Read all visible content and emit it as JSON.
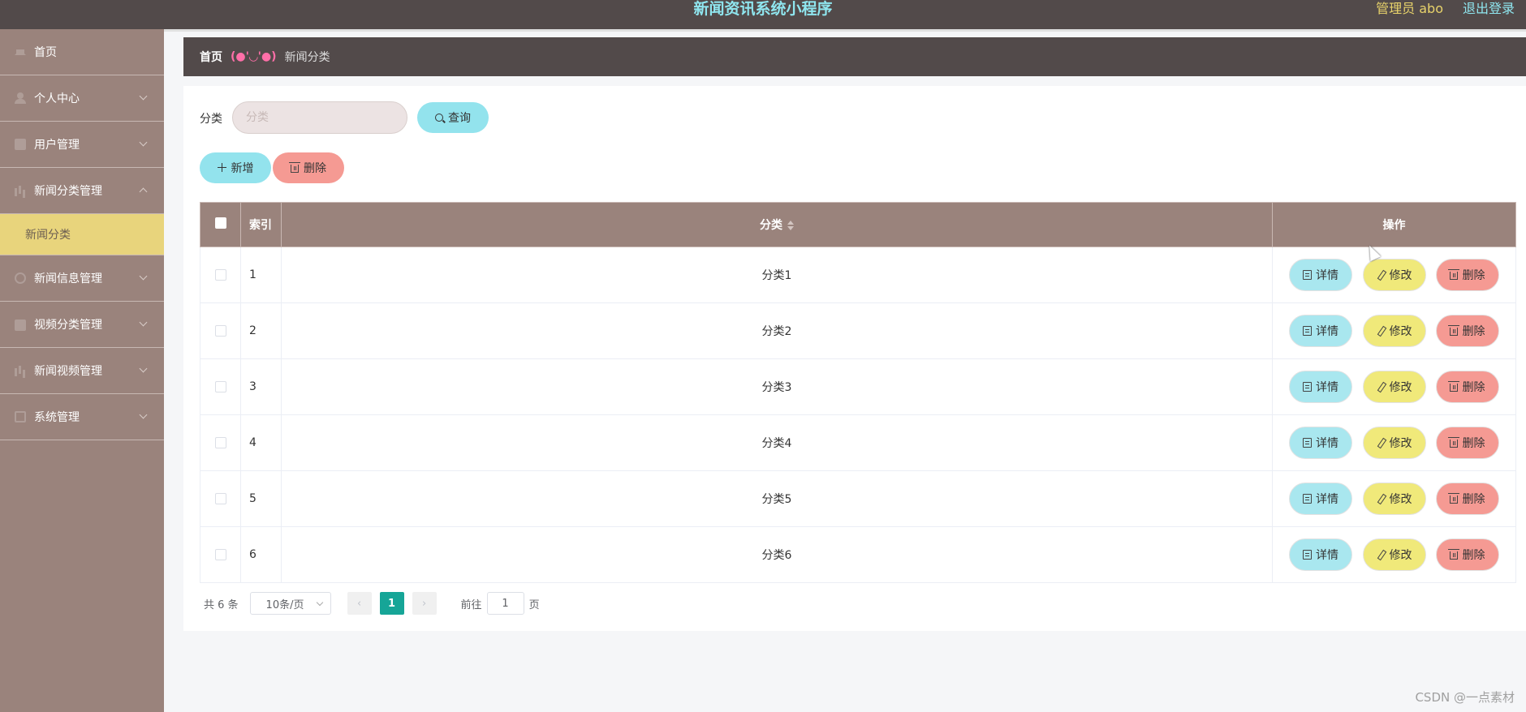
{
  "header": {
    "title": "新闻资讯系统小程序",
    "admin_label": "管理员 abo",
    "logout_label": "退出登录"
  },
  "sidebar": {
    "items": [
      {
        "label": "首页",
        "icon": "home-icon"
      },
      {
        "label": "个人中心",
        "icon": "user-icon"
      },
      {
        "label": "用户管理",
        "icon": "users-icon"
      },
      {
        "label": "新闻分类管理",
        "icon": "bar-chart-icon"
      },
      {
        "label": "新闻分类",
        "icon": ""
      },
      {
        "label": "新闻信息管理",
        "icon": "circle-icon"
      },
      {
        "label": "视频分类管理",
        "icon": "video-icon"
      },
      {
        "label": "新闻视频管理",
        "icon": "bar-chart-icon"
      },
      {
        "label": "系统管理",
        "icon": "settings-icon"
      }
    ],
    "active_sub": "新闻分类"
  },
  "breadcrumb": {
    "home": "首页",
    "separator": "(●'◡'●)",
    "current": "新闻分类"
  },
  "search": {
    "label": "分类",
    "placeholder": "分类",
    "query_label": "查询"
  },
  "actions": {
    "add_label": "新增",
    "delete_label": "删除"
  },
  "table": {
    "headers": {
      "index": "索引",
      "category": "分类",
      "operation": "操作"
    },
    "rows": [
      {
        "index": "1",
        "category": "分类1"
      },
      {
        "index": "2",
        "category": "分类2"
      },
      {
        "index": "3",
        "category": "分类3"
      },
      {
        "index": "4",
        "category": "分类4"
      },
      {
        "index": "5",
        "category": "分类5"
      },
      {
        "index": "6",
        "category": "分类6"
      }
    ],
    "row_actions": {
      "detail": "详情",
      "edit": "修改",
      "delete": "删除"
    }
  },
  "pagination": {
    "total": "共 6 条",
    "page_size": "10条/页",
    "current_page": "1",
    "goto_label": "前往",
    "goto_value": "1",
    "page_suffix": "页"
  },
  "watermark": "CSDN @一点素材",
  "colors": {
    "header_bg": "#524a4a",
    "sidebar_bg": "#9a837c",
    "active_sub_bg": "#e8d47c",
    "accent_cyan": "#93e3ed",
    "accent_yellow": "#f0e97a",
    "accent_red": "#f59a93",
    "page_active": "#16a597"
  }
}
